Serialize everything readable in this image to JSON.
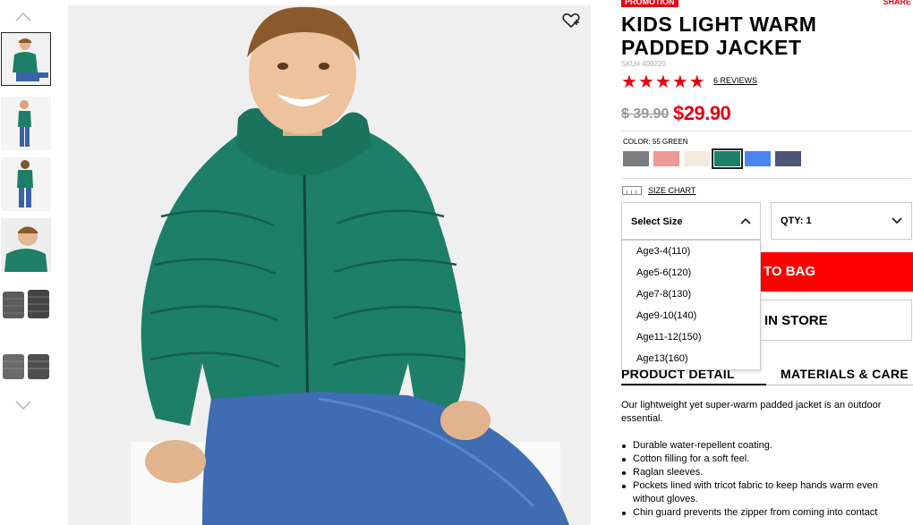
{
  "gallery": {
    "nav_up_icon": "chevron-up-icon",
    "nav_down_icon": "chevron-down-icon",
    "thumbnails": [
      {
        "label": "front-view",
        "active": true
      },
      {
        "label": "side-view",
        "active": false
      },
      {
        "label": "back-view",
        "active": false
      },
      {
        "label": "detail-view",
        "active": false
      },
      {
        "label": "folded-jacket",
        "active": false
      },
      {
        "label": "folded-jacket-pair",
        "active": false
      }
    ],
    "wishlist_icon": "heart-plus-icon"
  },
  "product": {
    "badge": "PROMOTION",
    "share": "SHARE",
    "title": "KIDS LIGHT WARM PADDED JACKET",
    "sku": "SKU# 409220",
    "rating": 5,
    "rating_max": 5,
    "reviews": "6 REVIEWS",
    "price_old": "$ 39.90",
    "price_new": "$29.90"
  },
  "color": {
    "label": "COLOR: 55 GREEN",
    "swatches": [
      {
        "name": "gray",
        "hex": "#7d7d7d"
      },
      {
        "name": "pink",
        "hex": "#ef9898"
      },
      {
        "name": "cream",
        "hex": "#f3ecdc"
      },
      {
        "name": "green",
        "hex": "#1d7f67",
        "selected": true
      },
      {
        "name": "blue",
        "hex": "#4a86f2"
      },
      {
        "name": "navy",
        "hex": "#4c5675"
      }
    ]
  },
  "size": {
    "chart_label": "SIZE CHART",
    "select_label": "Select Size",
    "options": [
      "Age3-4(110)",
      "Age5-6(120)",
      "Age7-8(130)",
      "Age9-10(140)",
      "Age11-12(150)",
      "Age13(160)"
    ]
  },
  "qty": {
    "label": "QTY: 1"
  },
  "actions": {
    "add_to_bag": "TO BAG",
    "find_in_store": "IN STORE"
  },
  "tabs": [
    {
      "label": "PRODUCT DETAIL",
      "active": true
    },
    {
      "label": "MATERIALS & CARE",
      "active": false
    }
  ],
  "details": {
    "description": "Our lightweight yet super-warm padded jacket is an outdoor essential.",
    "bullets": [
      "Durable water-repellent coating.",
      "Cotton filling for a soft feel.",
      "Raglan sleeves.",
      "Pockets lined with tricot fabric to keep hands warm even without gloves.",
      "Chin guard prevents the zipper from coming into contact"
    ]
  },
  "colors": {
    "brand_red": "#e60012",
    "button_red": "#ff0000",
    "jacket_green": "#1d7f67"
  }
}
